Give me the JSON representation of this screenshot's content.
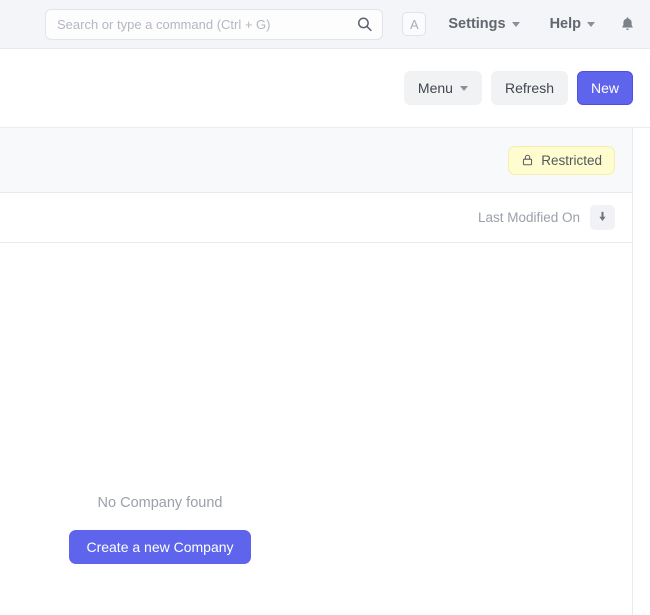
{
  "navbar": {
    "search": {
      "placeholder": "Search or type a command (Ctrl + G)",
      "value": "",
      "icon": "search-icon"
    },
    "avatar_letter": "A",
    "settings_label": "Settings",
    "help_label": "Help",
    "notifications_icon": "bell-icon"
  },
  "toolbar": {
    "menu_label": "Menu",
    "refresh_label": "Refresh",
    "new_label": "New"
  },
  "filter_bar": {
    "restricted_badge": "Restricted",
    "restricted_icon": "lock-icon"
  },
  "sort_bar": {
    "sort_field": "Last Modified On",
    "sort_direction_icon": "arrow-down-icon"
  },
  "empty_state": {
    "message": "No Company found",
    "create_label": "Create a new Company"
  },
  "colors": {
    "primary": "#5e64ec",
    "navbar_bg": "#f4f5f9",
    "filter_bg": "#f8f9fb",
    "badge_bg": "#fffccf",
    "badge_border": "#f3efb0",
    "muted_text": "#9ba0aa",
    "border": "#e9ebef"
  }
}
